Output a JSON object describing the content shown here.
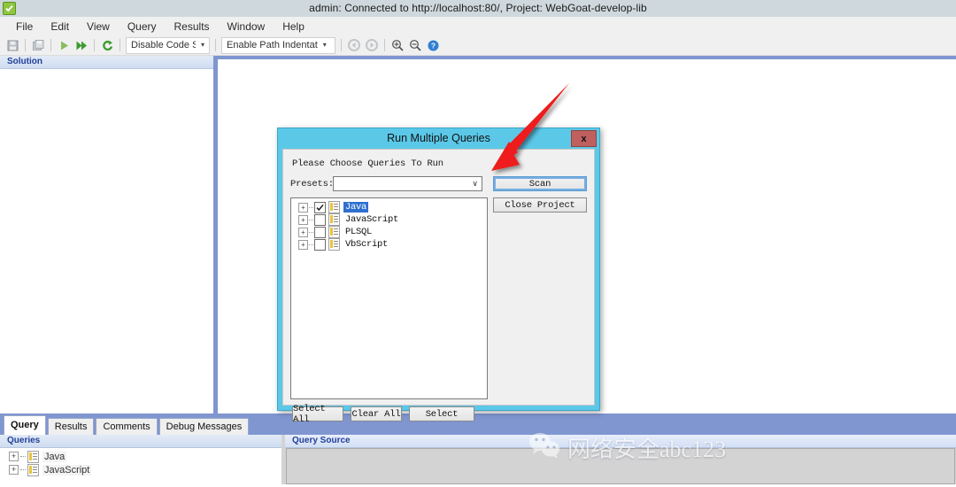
{
  "window": {
    "title": "admin: Connected to http://localhost:80/, Project: WebGoat-develop-lib",
    "app_icon": "green-check-icon"
  },
  "menubar": {
    "items": [
      {
        "label": "File"
      },
      {
        "label": "Edit"
      },
      {
        "label": "View"
      },
      {
        "label": "Query"
      },
      {
        "label": "Results"
      },
      {
        "label": "Window"
      },
      {
        "label": "Help"
      }
    ]
  },
  "toolbar": {
    "code_slicing": {
      "label": "Disable Code Slic",
      "arrow": "▾"
    },
    "path_indent": {
      "label": "Enable Path Indentat",
      "arrow": "▾"
    },
    "icons": [
      "save-icon",
      "save-all-icon",
      "run-icon",
      "run-all-icon",
      "refresh-icon",
      "back-icon",
      "forward-icon",
      "zoom-in-icon",
      "zoom-out-icon",
      "help-icon"
    ]
  },
  "solution_pane": {
    "header": "Solution"
  },
  "bottom_tabs": {
    "items": [
      {
        "label": "Query",
        "active": true
      },
      {
        "label": "Results",
        "active": false
      },
      {
        "label": "Comments",
        "active": false
      },
      {
        "label": "Debug Messages",
        "active": false
      }
    ]
  },
  "queries_pane": {
    "header": "Queries",
    "tree": [
      {
        "label": "Java",
        "expander": "+"
      },
      {
        "label": "JavaScript",
        "expander": "+"
      }
    ]
  },
  "query_source_pane": {
    "header": "Query Source"
  },
  "dialog": {
    "title": "Run Multiple Queries",
    "close_label": "x",
    "prompt": "Please Choose Queries To Run",
    "presets_label": "Presets:",
    "presets_value": "",
    "presets_arrow": "∨",
    "scan_button": "Scan",
    "close_project_button": "Close Project",
    "tree": [
      {
        "label": "Java",
        "checked": true,
        "selected": true,
        "expander": "+"
      },
      {
        "label": "JavaScript",
        "checked": false,
        "selected": false,
        "expander": "+"
      },
      {
        "label": "PLSQL",
        "checked": false,
        "selected": false,
        "expander": "+"
      },
      {
        "label": "VbScript",
        "checked": false,
        "selected": false,
        "expander": "+"
      }
    ],
    "select_all_button": "Select All",
    "clear_all_button": "Clear All",
    "select_button": "Select"
  },
  "annotation": {
    "arrow_color": "#ee1c1c",
    "name": "red-pointer-arrow"
  },
  "watermark": {
    "text": "网络安全abc123",
    "icon": "wechat-icon"
  },
  "colors": {
    "titlebar": "#cfd9dd",
    "dialog_frame": "#5cc8e8",
    "splitter": "#7f96d0",
    "pane_header_text": "#21409a",
    "selection": "#2f6fd0",
    "close_button": "#c0605e"
  }
}
